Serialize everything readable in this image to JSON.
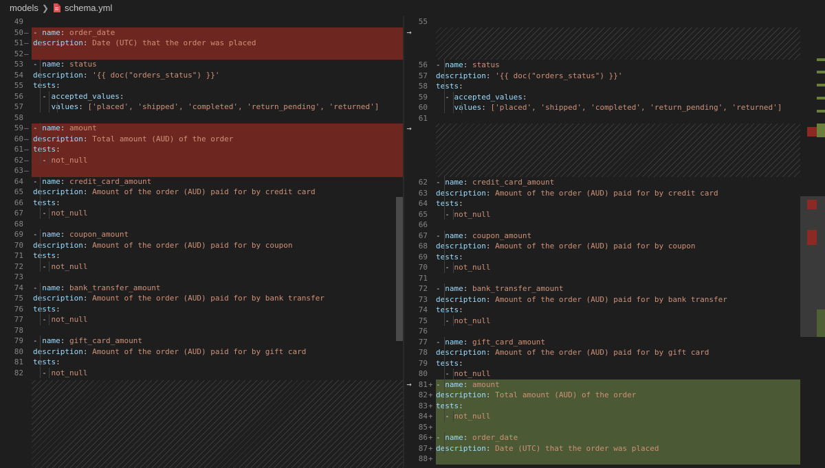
{
  "breadcrumb": {
    "folder": "models",
    "file": "schema.yml"
  },
  "icons": {
    "separator": "chevron-right-icon",
    "file": "yaml-file-icon",
    "move_arrow": "arrow-right-icon"
  },
  "colors": {
    "deleted": "#6e2720",
    "inserted": "#4b5a34",
    "key": "#9cdcfe",
    "string": "#ce9178",
    "punct": "#d4d4d4"
  },
  "arrow_glyph": "→",
  "left_lines": [
    {
      "n": "49",
      "m": "",
      "ind": 0,
      "t": "blank"
    },
    {
      "n": "50",
      "m": "—",
      "ind": 1,
      "t": "list",
      "k": "name",
      "v": "order_date"
    },
    {
      "n": "51",
      "m": "—",
      "ind": 1,
      "t": "kv",
      "k": "description",
      "v": "Date (UTC) that the order was placed"
    },
    {
      "n": "52",
      "m": "—",
      "ind": 0,
      "t": "blank"
    },
    {
      "n": "53",
      "m": "",
      "ind": 1,
      "t": "list",
      "k": "name",
      "v": "status"
    },
    {
      "n": "54",
      "m": "",
      "ind": 1,
      "t": "kv",
      "k": "description",
      "v": "'{{ doc(\"orders_status\") }}'"
    },
    {
      "n": "55",
      "m": "",
      "ind": 1,
      "t": "key",
      "k": "tests"
    },
    {
      "n": "56",
      "m": "",
      "ind": 2,
      "t": "listkey",
      "k": "accepted_values"
    },
    {
      "n": "57",
      "m": "",
      "ind": 3,
      "t": "values",
      "k": "values",
      "v": "['placed', 'shipped', 'completed', 'return_pending', 'returned']"
    },
    {
      "n": "58",
      "m": "",
      "ind": 0,
      "t": "blank"
    },
    {
      "n": "59",
      "m": "—",
      "ind": 1,
      "t": "list",
      "k": "name",
      "v": "amount"
    },
    {
      "n": "60",
      "m": "—",
      "ind": 1,
      "t": "kv",
      "k": "description",
      "v": "Total amount (AUD) of the order"
    },
    {
      "n": "61",
      "m": "—",
      "ind": 1,
      "t": "key",
      "k": "tests"
    },
    {
      "n": "62",
      "m": "—",
      "ind": 2,
      "t": "item",
      "v": "not_null"
    },
    {
      "n": "63",
      "m": "—",
      "ind": 0,
      "t": "blank"
    },
    {
      "n": "64",
      "m": "",
      "ind": 1,
      "t": "list",
      "k": "name",
      "v": "credit_card_amount"
    },
    {
      "n": "65",
      "m": "",
      "ind": 1,
      "t": "kv",
      "k": "description",
      "v": "Amount of the order (AUD) paid for by credit card"
    },
    {
      "n": "66",
      "m": "",
      "ind": 1,
      "t": "key",
      "k": "tests"
    },
    {
      "n": "67",
      "m": "",
      "ind": 2,
      "t": "item",
      "v": "not_null"
    },
    {
      "n": "68",
      "m": "",
      "ind": 0,
      "t": "blank"
    },
    {
      "n": "69",
      "m": "",
      "ind": 1,
      "t": "list",
      "k": "name",
      "v": "coupon_amount"
    },
    {
      "n": "70",
      "m": "",
      "ind": 1,
      "t": "kv",
      "k": "description",
      "v": "Amount of the order (AUD) paid for by coupon"
    },
    {
      "n": "71",
      "m": "",
      "ind": 1,
      "t": "key",
      "k": "tests"
    },
    {
      "n": "72",
      "m": "",
      "ind": 2,
      "t": "item",
      "v": "not_null"
    },
    {
      "n": "73",
      "m": "",
      "ind": 0,
      "t": "blank"
    },
    {
      "n": "74",
      "m": "",
      "ind": 1,
      "t": "list",
      "k": "name",
      "v": "bank_transfer_amount"
    },
    {
      "n": "75",
      "m": "",
      "ind": 1,
      "t": "kv",
      "k": "description",
      "v": "Amount of the order (AUD) paid for by bank transfer"
    },
    {
      "n": "76",
      "m": "",
      "ind": 1,
      "t": "key",
      "k": "tests"
    },
    {
      "n": "77",
      "m": "",
      "ind": 2,
      "t": "item",
      "v": "not_null"
    },
    {
      "n": "78",
      "m": "",
      "ind": 0,
      "t": "blank"
    },
    {
      "n": "79",
      "m": "",
      "ind": 1,
      "t": "list",
      "k": "name",
      "v": "gift_card_amount"
    },
    {
      "n": "80",
      "m": "",
      "ind": 1,
      "t": "kv",
      "k": "description",
      "v": "Amount of the order (AUD) paid for by gift card"
    },
    {
      "n": "81",
      "m": "",
      "ind": 1,
      "t": "key",
      "k": "tests"
    },
    {
      "n": "82",
      "m": "",
      "ind": 2,
      "t": "item",
      "v": "not_null"
    }
  ],
  "right_lines": [
    {
      "n": "55",
      "m": "",
      "ind": 0,
      "t": "blank"
    },
    {
      "n": "56",
      "m": "",
      "ind": 1,
      "t": "list",
      "k": "name",
      "v": "status"
    },
    {
      "n": "57",
      "m": "",
      "ind": 1,
      "t": "kv",
      "k": "description",
      "v": "'{{ doc(\"orders_status\") }}'"
    },
    {
      "n": "58",
      "m": "",
      "ind": 1,
      "t": "key",
      "k": "tests"
    },
    {
      "n": "59",
      "m": "",
      "ind": 2,
      "t": "listkey",
      "k": "accepted_values"
    },
    {
      "n": "60",
      "m": "",
      "ind": 3,
      "t": "values",
      "k": "values",
      "v": "['placed', 'shipped', 'completed', 'return_pending', 'returned']"
    },
    {
      "n": "61",
      "m": "",
      "ind": 0,
      "t": "blank"
    },
    {
      "n": "62",
      "m": "",
      "ind": 1,
      "t": "list",
      "k": "name",
      "v": "credit_card_amount"
    },
    {
      "n": "63",
      "m": "",
      "ind": 1,
      "t": "kv",
      "k": "description",
      "v": "Amount of the order (AUD) paid for by credit card"
    },
    {
      "n": "64",
      "m": "",
      "ind": 1,
      "t": "key",
      "k": "tests"
    },
    {
      "n": "65",
      "m": "",
      "ind": 2,
      "t": "item",
      "v": "not_null"
    },
    {
      "n": "66",
      "m": "",
      "ind": 0,
      "t": "blank"
    },
    {
      "n": "67",
      "m": "",
      "ind": 1,
      "t": "list",
      "k": "name",
      "v": "coupon_amount"
    },
    {
      "n": "68",
      "m": "",
      "ind": 1,
      "t": "kv",
      "k": "description",
      "v": "Amount of the order (AUD) paid for by coupon"
    },
    {
      "n": "69",
      "m": "",
      "ind": 1,
      "t": "key",
      "k": "tests"
    },
    {
      "n": "70",
      "m": "",
      "ind": 2,
      "t": "item",
      "v": "not_null"
    },
    {
      "n": "71",
      "m": "",
      "ind": 0,
      "t": "blank"
    },
    {
      "n": "72",
      "m": "",
      "ind": 1,
      "t": "list",
      "k": "name",
      "v": "bank_transfer_amount"
    },
    {
      "n": "73",
      "m": "",
      "ind": 1,
      "t": "kv",
      "k": "description",
      "v": "Amount of the order (AUD) paid for by bank transfer"
    },
    {
      "n": "74",
      "m": "",
      "ind": 1,
      "t": "key",
      "k": "tests"
    },
    {
      "n": "75",
      "m": "",
      "ind": 2,
      "t": "item",
      "v": "not_null"
    },
    {
      "n": "76",
      "m": "",
      "ind": 0,
      "t": "blank"
    },
    {
      "n": "77",
      "m": "",
      "ind": 1,
      "t": "list",
      "k": "name",
      "v": "gift_card_amount"
    },
    {
      "n": "78",
      "m": "",
      "ind": 1,
      "t": "kv",
      "k": "description",
      "v": "Amount of the order (AUD) paid for by gift card"
    },
    {
      "n": "79",
      "m": "",
      "ind": 1,
      "t": "key",
      "k": "tests"
    },
    {
      "n": "80",
      "m": "",
      "ind": 2,
      "t": "item",
      "v": "not_null"
    },
    {
      "n": "81",
      "m": "+",
      "ind": 1,
      "t": "list",
      "k": "name",
      "v": "amount"
    },
    {
      "n": "82",
      "m": "+",
      "ind": 1,
      "t": "kv",
      "k": "description",
      "v": "Total amount (AUD) of the order"
    },
    {
      "n": "83",
      "m": "+",
      "ind": 1,
      "t": "key",
      "k": "tests"
    },
    {
      "n": "84",
      "m": "+",
      "ind": 2,
      "t": "item",
      "v": "not_null"
    },
    {
      "n": "85",
      "m": "+",
      "ind": 0,
      "t": "blank"
    },
    {
      "n": "86",
      "m": "+",
      "ind": 1,
      "t": "list",
      "k": "name",
      "v": "order_date"
    },
    {
      "n": "87",
      "m": "+",
      "ind": 1,
      "t": "kv",
      "k": "description",
      "v": "Date (UTC) that the order was placed"
    },
    {
      "n": "88",
      "m": "+",
      "ind": 0,
      "t": "blank"
    }
  ]
}
